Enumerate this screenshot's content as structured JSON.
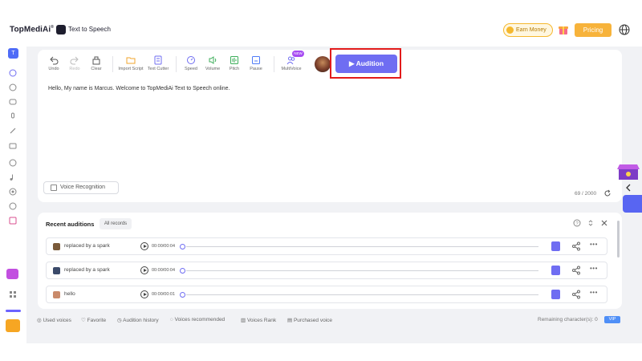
{
  "header": {
    "brand": "TopMediAi",
    "brand_mark": "®",
    "product": "Text to Speech",
    "earn_money": "Earn Money",
    "pricing": "Pricing"
  },
  "toolbar": {
    "tools": [
      {
        "label": "Undo",
        "icon": "undo-icon"
      },
      {
        "label": "Redo",
        "icon": "redo-icon"
      },
      {
        "label": "Clear",
        "icon": "clear-icon"
      },
      {
        "label": "Import Script",
        "icon": "folder-icon"
      },
      {
        "label": "Text Cutter",
        "icon": "text-cutter-icon"
      },
      {
        "label": "Speed",
        "icon": "speed-icon"
      },
      {
        "label": "Volume",
        "icon": "volume-icon"
      },
      {
        "label": "Pitch",
        "icon": "pitch-icon"
      },
      {
        "label": "Pause",
        "icon": "pause-icon"
      },
      {
        "label": "MultiVoice",
        "icon": "multivoice-icon"
      }
    ],
    "new_badge": "NEW",
    "audition_label": "Audition"
  },
  "editor": {
    "text": "Hello, My name is Marcus. Welcome to TopMediAi Text to Speech online.",
    "voice_recognition": "Voice Recognition",
    "char_count": "69 / 2000"
  },
  "recent": {
    "title": "Recent auditions",
    "filter": "All records",
    "rows": [
      {
        "name": "replaced by a spark",
        "time": "00:00/00:04"
      },
      {
        "name": "replaced by a spark",
        "time": "00:00/00:04"
      },
      {
        "name": "hello",
        "time": "00:00/00:01"
      }
    ]
  },
  "bottom_bar": {
    "items": [
      "Used voices",
      "Favorite",
      "Audition history",
      "Voices recommended",
      "Voices Rank",
      "Purchased voice"
    ],
    "remaining": "Remaining character(s): 0",
    "badge": "VIP"
  },
  "colors": {
    "accent": "#6f6df2",
    "pricing": "#f7b33b",
    "highlight": "#e21b1b"
  }
}
